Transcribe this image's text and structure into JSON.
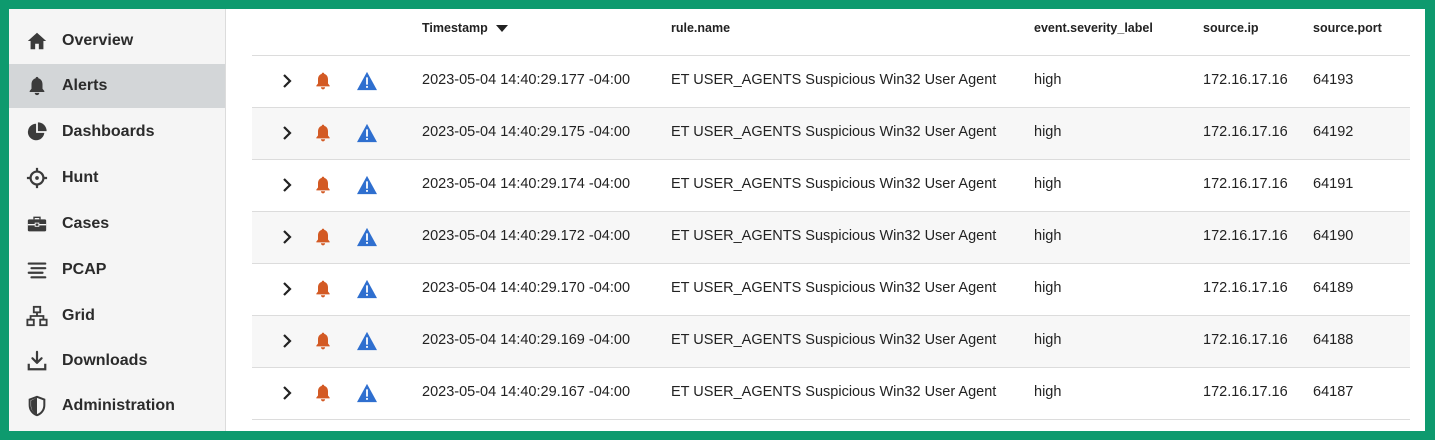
{
  "sidebar": {
    "items": [
      {
        "label": "Overview",
        "icon": "home-icon"
      },
      {
        "label": "Alerts",
        "icon": "bell-icon",
        "active": true
      },
      {
        "label": "Dashboards",
        "icon": "pie-chart-icon"
      },
      {
        "label": "Hunt",
        "icon": "crosshair-icon"
      },
      {
        "label": "Cases",
        "icon": "briefcase-icon"
      },
      {
        "label": "PCAP",
        "icon": "stream-lines-icon"
      },
      {
        "label": "Grid",
        "icon": "network-icon"
      },
      {
        "label": "Downloads",
        "icon": "download-icon"
      },
      {
        "label": "Administration",
        "icon": "shield-icon"
      }
    ]
  },
  "table": {
    "headers": {
      "timestamp": "Timestamp",
      "rule": "rule.name",
      "severity": "event.severity_label",
      "ip": "source.ip",
      "port": "source.port"
    },
    "rows": [
      {
        "timestamp": "2023-05-04 14:40:29.177 -04:00",
        "rule": "ET USER_AGENTS Suspicious Win32 User Agent",
        "severity": "high",
        "ip": "172.16.17.16",
        "port": "64193"
      },
      {
        "timestamp": "2023-05-04 14:40:29.175 -04:00",
        "rule": "ET USER_AGENTS Suspicious Win32 User Agent",
        "severity": "high",
        "ip": "172.16.17.16",
        "port": "64192"
      },
      {
        "timestamp": "2023-05-04 14:40:29.174 -04:00",
        "rule": "ET USER_AGENTS Suspicious Win32 User Agent",
        "severity": "high",
        "ip": "172.16.17.16",
        "port": "64191"
      },
      {
        "timestamp": "2023-05-04 14:40:29.172 -04:00",
        "rule": "ET USER_AGENTS Suspicious Win32 User Agent",
        "severity": "high",
        "ip": "172.16.17.16",
        "port": "64190"
      },
      {
        "timestamp": "2023-05-04 14:40:29.170 -04:00",
        "rule": "ET USER_AGENTS Suspicious Win32 User Agent",
        "severity": "high",
        "ip": "172.16.17.16",
        "port": "64189"
      },
      {
        "timestamp": "2023-05-04 14:40:29.169 -04:00",
        "rule": "ET USER_AGENTS Suspicious Win32 User Agent",
        "severity": "high",
        "ip": "172.16.17.16",
        "port": "64188"
      },
      {
        "timestamp": "2023-05-04 14:40:29.167 -04:00",
        "rule": "ET USER_AGENTS Suspicious Win32 User Agent",
        "severity": "high",
        "ip": "172.16.17.16",
        "port": "64187"
      }
    ]
  },
  "colors": {
    "border": "#0e9a6e",
    "bell": "#d35a24",
    "warning": "#2f6fcf"
  }
}
